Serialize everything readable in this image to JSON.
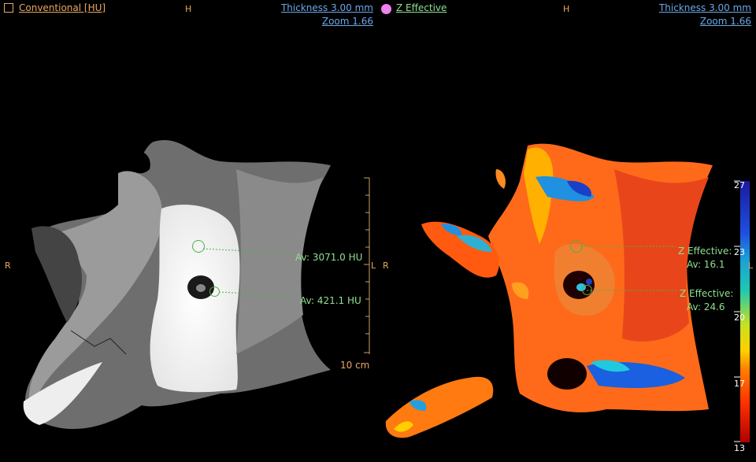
{
  "left": {
    "title": "Conventional [HU]",
    "top_orient": "H",
    "thickness": "Thickness 3.00 mm",
    "zoom": "Zoom 1.66",
    "right_orient": "R",
    "left_orient": "L",
    "scale": "10 cm",
    "roi1": "Av:  3071.0 HU",
    "roi2": "Av:  421.1 HU"
  },
  "right": {
    "title": "Z Effective",
    "top_orient": "H",
    "thickness": "Thickness 3.00 mm",
    "zoom": "Zoom 1.66",
    "right_orient": "R",
    "left_orient": "L",
    "roi1_name": "Z Effective:",
    "roi1_val": "Av:  16.1",
    "roi2_name": "Z Effective:",
    "roi2_val": "Av:  24.6",
    "colorbar_labels": [
      "27",
      "23",
      "20",
      "17",
      "13"
    ]
  },
  "colors": {
    "orange": "#e8a860",
    "blue_link": "#6aa8e8",
    "green_text": "#8fe08f",
    "magenta": "#ee82ee"
  }
}
